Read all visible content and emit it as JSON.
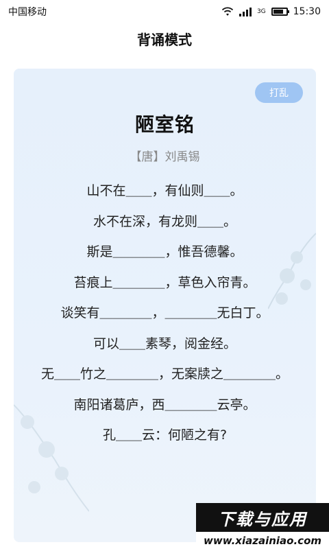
{
  "status_bar": {
    "carrier": "中国移动",
    "network": "3G",
    "battery_level": 0.8,
    "time": "15:30"
  },
  "header": {
    "title": "背诵模式"
  },
  "card": {
    "shuffle_label": "打乱",
    "poem_title": "陋室铭",
    "poem_author": "【唐】刘禹锡",
    "lines": [
      "山不在＿＿，有仙则＿＿。",
      "水不在深，有龙则＿＿。",
      "斯是＿＿＿＿，惟吾德馨。",
      "苔痕上＿＿＿＿，草色入帘青。",
      "谈笑有＿＿＿＿，＿＿＿＿无白丁。",
      "可以＿＿素琴，阅金经。",
      "无＿＿竹之＿＿＿＿，无案牍之＿＿＿＿。",
      "南阳诸葛庐，西＿＿＿＿云亭。",
      "孔＿＿云：何陋之有?"
    ]
  },
  "watermark": {
    "brand": "下载与应用",
    "url": "www.xiazainiao.com"
  },
  "colors": {
    "card_bg": "#e6f0fb",
    "shuffle_bg": "#9fc5f3",
    "author_text": "#888888"
  }
}
